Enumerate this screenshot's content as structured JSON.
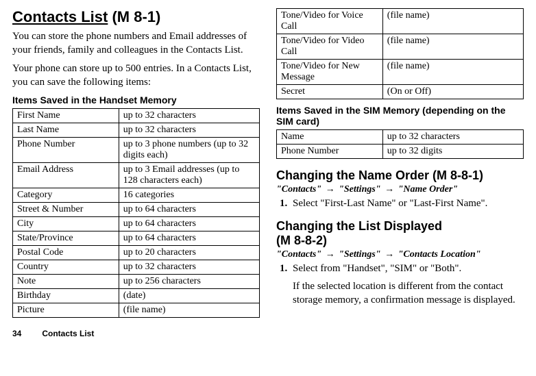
{
  "left": {
    "title_underline": "Contacts List",
    "title_suffix": " (M 8-1)",
    "intro1": "You can store the phone numbers and Email addresses of your friends, family and colleagues in the Contacts List.",
    "intro2": "Your phone can store up to 500 entries. In a Contacts List, you can save the following items:",
    "subhead": "Items Saved in the Handset Memory",
    "table": [
      [
        "First Name",
        "up to 32 characters"
      ],
      [
        "Last Name",
        "up to 32 characters"
      ],
      [
        "Phone Number",
        "up to 3 phone numbers (up to 32 digits each)"
      ],
      [
        "Email Address",
        "up to 3 Email addresses (up to 128 characters each)"
      ],
      [
        "Category",
        "16 categories"
      ],
      [
        "Street & Number",
        "up to 64 characters"
      ],
      [
        "City",
        "up to 64 characters"
      ],
      [
        "State/Province",
        "up to 64 characters"
      ],
      [
        "Postal Code",
        "up to 20 characters"
      ],
      [
        "Country",
        "up to 32 characters"
      ],
      [
        "Note",
        "up to 256 characters"
      ],
      [
        "Birthday",
        "(date)"
      ],
      [
        "Picture",
        "(file name)"
      ]
    ]
  },
  "right": {
    "top_table": [
      [
        "Tone/Video for Voice Call",
        "(file name)"
      ],
      [
        "Tone/Video for Video Call",
        "(file name)"
      ],
      [
        "Tone/Video for New Message",
        "(file name)"
      ],
      [
        "Secret",
        "(On or Off)"
      ]
    ],
    "sim_head": "Items Saved in the SIM Memory (depending on the SIM card)",
    "sim_table": [
      [
        "Name",
        "up to 32 characters"
      ],
      [
        "Phone Number",
        "up to 32 digits"
      ]
    ],
    "sec1_title": "Changing the Name Order",
    "sec1_suffix": " (M 8-8-1)",
    "sec1_crumb": [
      "\"Contacts\"",
      "\"Settings\"",
      "\"Name Order\""
    ],
    "sec1_step": "Select \"First-Last Name\" or \"Last-First Name\".",
    "sec2_title": "Changing the List Displayed",
    "sec2_suffix": "(M 8-8-2)",
    "sec2_crumb": [
      "\"Contacts\"",
      "\"Settings\"",
      "\"Contacts Location\""
    ],
    "sec2_step": "Select from \"Handset\", \"SIM\" or \"Both\".",
    "sec2_note": "If the selected location is different from the contact storage memory, a confirmation message is displayed."
  },
  "footer": {
    "page": "34",
    "chapter": "Contacts List"
  },
  "arrow": "→"
}
